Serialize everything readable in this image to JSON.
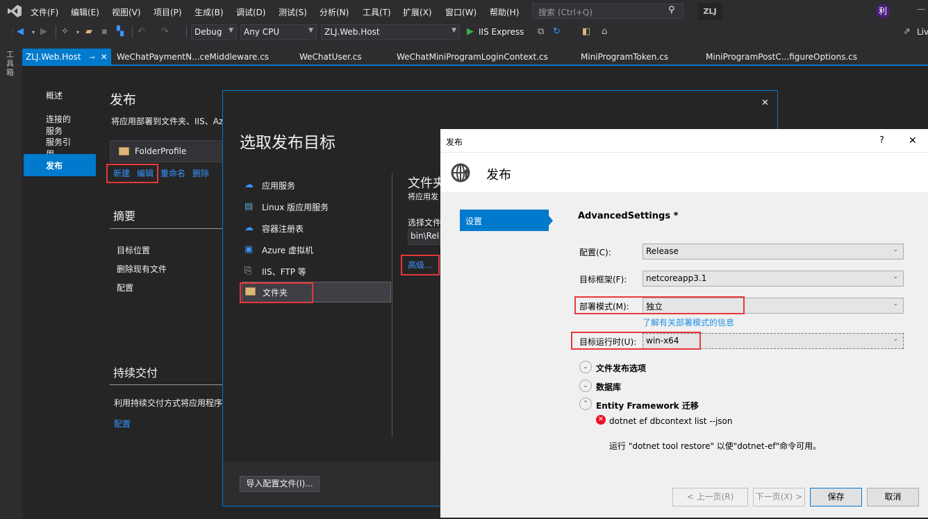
{
  "menubar": {
    "items": [
      "文件(F)",
      "编辑(E)",
      "视图(V)",
      "项目(P)",
      "生成(B)",
      "调试(D)",
      "测试(S)",
      "分析(N)",
      "工具(T)",
      "扩展(X)",
      "窗口(W)",
      "帮助(H)"
    ],
    "search_placeholder": "搜索 (Ctrl+Q)",
    "solution_badge": "ZLJ",
    "avatar_initial": "利",
    "minimize_glyph": "—"
  },
  "toolbar": {
    "configuration": "Debug",
    "platform": "Any CPU",
    "startup_project": "ZLJ.Web.Host",
    "run_label": "IIS Express",
    "live_share": "Liv"
  },
  "toolbox_label": "工具箱",
  "tabs": [
    {
      "label": "ZLJ.Web.Host",
      "active": true
    },
    {
      "label": "WeChatPaymentN...ceMiddleware.cs"
    },
    {
      "label": "WeChatUser.cs"
    },
    {
      "label": "WeChatMiniProgramLoginContext.cs"
    },
    {
      "label": "MiniProgramToken.cs"
    },
    {
      "label": "MiniProgramPostC...figureOptions.cs"
    }
  ],
  "project_nav": {
    "items": [
      "概述",
      "连接的服务",
      "服务引用",
      "发布"
    ],
    "active": "发布"
  },
  "publish_page": {
    "title": "发布",
    "description": "将应用部署到文件夹、IIS、Az",
    "profile_name": "FolderProfile",
    "actions": [
      "新建",
      "编辑",
      "重命名",
      "删除"
    ],
    "summary_title": "摘要",
    "summary_items": [
      "目标位置",
      "删除现有文件",
      "配置"
    ],
    "cd_title": "持续交付",
    "cd_description": "利用持续交付方式将应用程序",
    "cd_link": "配置"
  },
  "pick_target_dialog": {
    "title": "选取发布目标",
    "close_glyph": "✕",
    "targets": [
      "应用服务",
      "Linux 版应用服务",
      "容器注册表",
      "Azure 虚拟机",
      "IIS、FTP 等",
      "文件夹"
    ],
    "selected_target": "文件夹",
    "folder_heading": "文件夹",
    "folder_desc": "将应用发",
    "choose_folder_label": "选择文件",
    "folder_path": "bin\\Rele",
    "advanced_link": "高级...",
    "import_button": "导入配置文件(I)..."
  },
  "publish_dialog": {
    "window_title": "发布",
    "help_glyph": "?",
    "close_glyph": "✕",
    "header_title": "发布",
    "side_tab": "设置",
    "section_title": "AdvancedSettings *",
    "fields": [
      {
        "label": "配置(C):",
        "value": "Release"
      },
      {
        "label": "目标框架(F):",
        "value": "netcoreapp3.1"
      },
      {
        "label": "部署模式(M):",
        "value": "独立"
      },
      {
        "label": "目标运行时(U):",
        "value": "win-x64"
      }
    ],
    "deploy_mode_link": "了解有关部署模式的信息",
    "sections": [
      {
        "label": "文件发布选项",
        "expanded": false
      },
      {
        "label": "数据库",
        "expanded": false
      },
      {
        "label": "Entity Framework 迁移",
        "expanded": true
      }
    ],
    "ef_error_command": "dotnet ef dbcontext list --json",
    "ef_error_message": "运行 \"dotnet tool restore\" 以使\"dotnet-ef\"命令可用。",
    "buttons": {
      "prev": "< 上一页(R)",
      "next": "下一页(X) >",
      "save": "保存",
      "cancel": "取消"
    }
  },
  "colors": {
    "accent": "#007acc",
    "link": "#3794ff",
    "highlight_box": "#e8383a",
    "error": "#e81123"
  }
}
